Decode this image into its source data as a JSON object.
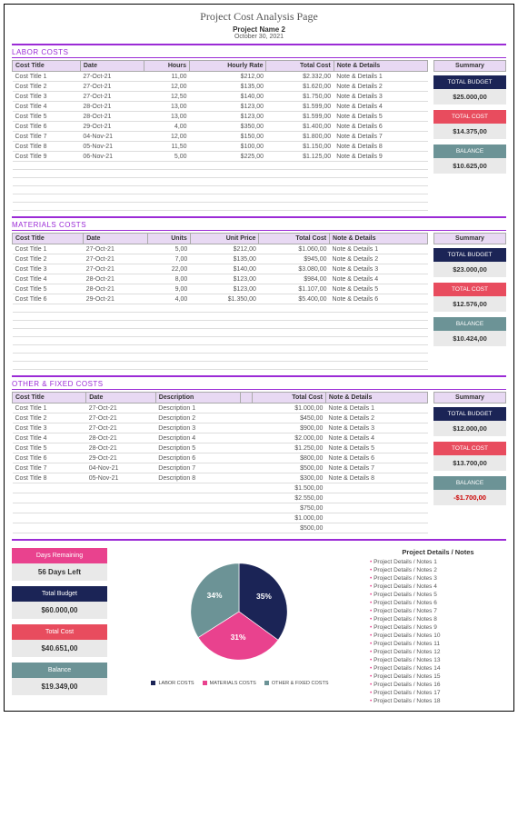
{
  "header": {
    "title": "Project Cost Analysis Page",
    "project": "Project Name 2",
    "date": "October 30, 2021"
  },
  "sections": {
    "labor": {
      "label": "LABOR COSTS",
      "columns": [
        "Cost Title",
        "Date",
        "Hours",
        "Hourly Rate",
        "Total Cost",
        "Note & Details"
      ],
      "rows": [
        {
          "title": "Cost Title 1",
          "date": "27-Oct-21",
          "qty": "11,00",
          "price": "$212,00",
          "total": "$2.332,00",
          "note": "Note & Details 1"
        },
        {
          "title": "Cost Title 2",
          "date": "27-Oct-21",
          "qty": "12,00",
          "price": "$135,00",
          "total": "$1.620,00",
          "note": "Note & Details 2"
        },
        {
          "title": "Cost Title 3",
          "date": "27-Oct-21",
          "qty": "12,50",
          "price": "$140,00",
          "total": "$1.750,00",
          "note": "Note & Details 3"
        },
        {
          "title": "Cost Title 4",
          "date": "28-Oct-21",
          "qty": "13,00",
          "price": "$123,00",
          "total": "$1.599,00",
          "note": "Note & Details 4"
        },
        {
          "title": "Cost Title 5",
          "date": "28-Oct-21",
          "qty": "13,00",
          "price": "$123,00",
          "total": "$1.599,00",
          "note": "Note & Details 5"
        },
        {
          "title": "Cost Title 6",
          "date": "29-Oct-21",
          "qty": "4,00",
          "price": "$350,00",
          "total": "$1.400,00",
          "note": "Note & Details 6"
        },
        {
          "title": "Cost Title 7",
          "date": "04-Nov-21",
          "qty": "12,00",
          "price": "$150,00",
          "total": "$1.800,00",
          "note": "Note & Details 7"
        },
        {
          "title": "Cost Title 8",
          "date": "05-Nov-21",
          "qty": "11,50",
          "price": "$100,00",
          "total": "$1.150,00",
          "note": "Note & Details 8"
        },
        {
          "title": "Cost Title 9",
          "date": "06-Nov-21",
          "qty": "5,00",
          "price": "$225,00",
          "total": "$1.125,00",
          "note": "Note & Details 9"
        }
      ],
      "summary": {
        "budget_label": "TOTAL BUDGET",
        "budget": "$25.000,00",
        "cost_label": "TOTAL COST",
        "cost": "$14.375,00",
        "balance_label": "BALANCE",
        "balance": "$10.625,00"
      }
    },
    "materials": {
      "label": "MATERIALS COSTS",
      "columns": [
        "Cost Title",
        "Date",
        "Units",
        "Unit Price",
        "Total Cost",
        "Note & Details"
      ],
      "rows": [
        {
          "title": "Cost Title 1",
          "date": "27-Oct-21",
          "qty": "5,00",
          "price": "$212,00",
          "total": "$1.060,00",
          "note": "Note & Details 1"
        },
        {
          "title": "Cost Title 2",
          "date": "27-Oct-21",
          "qty": "7,00",
          "price": "$135,00",
          "total": "$945,00",
          "note": "Note & Details 2"
        },
        {
          "title": "Cost Title 3",
          "date": "27-Oct-21",
          "qty": "22,00",
          "price": "$140,00",
          "total": "$3.080,00",
          "note": "Note & Details 3"
        },
        {
          "title": "Cost Title 4",
          "date": "28-Oct-21",
          "qty": "8,00",
          "price": "$123,00",
          "total": "$984,00",
          "note": "Note & Details 4"
        },
        {
          "title": "Cost Title 5",
          "date": "28-Oct-21",
          "qty": "9,00",
          "price": "$123,00",
          "total": "$1.107,00",
          "note": "Note & Details 5"
        },
        {
          "title": "Cost Title 6",
          "date": "29-Oct-21",
          "qty": "4,00",
          "price": "$1.350,00",
          "total": "$5.400,00",
          "note": "Note & Details 6"
        }
      ],
      "summary": {
        "budget_label": "TOTAL BUDGET",
        "budget": "$23.000,00",
        "cost_label": "TOTAL COST",
        "cost": "$12.576,00",
        "balance_label": "BALANCE",
        "balance": "$10.424,00"
      }
    },
    "other": {
      "label": "OTHER & FIXED COSTS",
      "columns": [
        "Cost Title",
        "Date",
        "Description",
        "",
        "Total Cost",
        "Note & Details"
      ],
      "rows": [
        {
          "title": "Cost Title 1",
          "date": "27-Oct-21",
          "desc": "Description 1",
          "total": "$1.000,00",
          "note": "Note & Details 1"
        },
        {
          "title": "Cost Title 2",
          "date": "27-Oct-21",
          "desc": "Description 2",
          "total": "$450,00",
          "note": "Note & Details 2"
        },
        {
          "title": "Cost Title 3",
          "date": "27-Oct-21",
          "desc": "Description 3",
          "total": "$900,00",
          "note": "Note & Details 3"
        },
        {
          "title": "Cost Title 4",
          "date": "28-Oct-21",
          "desc": "Description 4",
          "total": "$2.000,00",
          "note": "Note & Details 4"
        },
        {
          "title": "Cost Title 5",
          "date": "28-Oct-21",
          "desc": "Description 5",
          "total": "$1.250,00",
          "note": "Note & Details 5"
        },
        {
          "title": "Cost Title 6",
          "date": "29-Oct-21",
          "desc": "Description 6",
          "total": "$800,00",
          "note": "Note & Details 6"
        },
        {
          "title": "Cost Title 7",
          "date": "04-Nov-21",
          "desc": "Description 7",
          "total": "$500,00",
          "note": "Note & Details 7"
        },
        {
          "title": "Cost Title 8",
          "date": "05-Nov-21",
          "desc": "Description 8",
          "total": "$300,00",
          "note": "Note & Details 8"
        }
      ],
      "extra_totals": [
        "$1.500,00",
        "$2.550,00",
        "$750,00",
        "$1.000,00",
        "$500,00"
      ],
      "summary": {
        "budget_label": "TOTAL BUDGET",
        "budget": "$12.000,00",
        "cost_label": "TOTAL COST",
        "cost": "$13.700,00",
        "balance_label": "BALANCE",
        "balance": "-$1.700,00",
        "balance_neg": true
      }
    }
  },
  "summary_header": "Summary",
  "footer": {
    "days": {
      "label": "Days Remaining",
      "value": "56 Days Left"
    },
    "budget": {
      "label": "Total Budget",
      "value": "$60.000,00"
    },
    "cost": {
      "label": "Total Cost",
      "value": "$40.651,00"
    },
    "balance": {
      "label": "Balance",
      "value": "$19.349,00"
    }
  },
  "notes": {
    "title": "Project Details / Notes",
    "items": [
      "Project Details / Notes 1",
      "Project Details / Notes 2",
      "Project Details / Notes 3",
      "Project Details / Notes 4",
      "Project Details / Notes 5",
      "Project Details / Notes 6",
      "Project Details / Notes 7",
      "Project Details / Notes 8",
      "Project Details / Notes 9",
      "Project Details / Notes 10",
      "Project Details / Notes 11",
      "Project Details / Notes 12",
      "Project Details / Notes 13",
      "Project Details / Notes 14",
      "Project Details / Notes 15",
      "Project Details / Notes 16",
      "Project Details / Notes 17",
      "Project Details / Notes 18"
    ]
  },
  "chart_data": {
    "type": "pie",
    "title": "",
    "series": [
      {
        "name": "LABOR COSTS",
        "value": 35,
        "label": "35%",
        "color": "#1b2456"
      },
      {
        "name": "MATERIALS COSTS",
        "value": 31,
        "label": "31%",
        "color": "#e9428e"
      },
      {
        "name": "OTHER & FIXED COSTS",
        "value": 34,
        "label": "34%",
        "color": "#6c9396"
      }
    ]
  },
  "colors": {
    "purple": "#9b2bd6",
    "navy": "#1b2456",
    "red": "#e84c5e",
    "teal": "#6c9396",
    "pink": "#e9428e"
  }
}
